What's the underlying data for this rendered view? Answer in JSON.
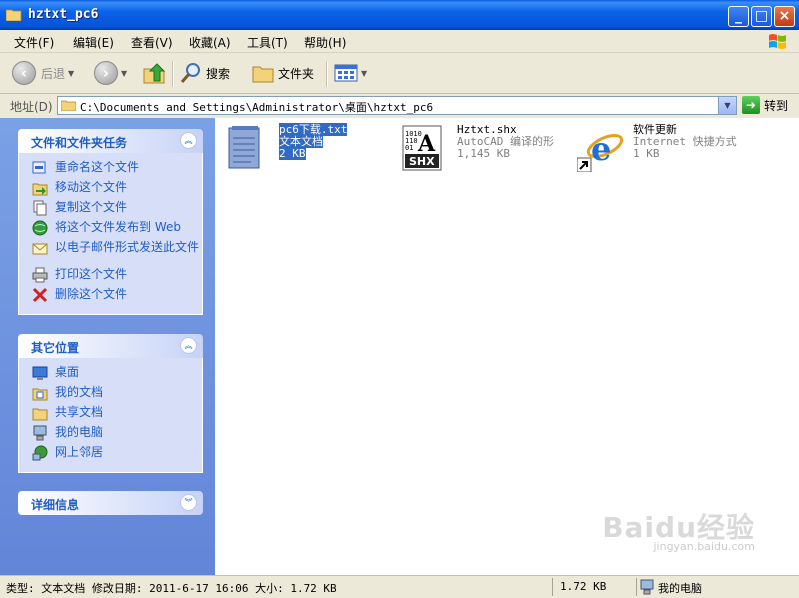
{
  "window": {
    "title": "hztxt_pc6"
  },
  "menu": [
    "文件(F)",
    "编辑(E)",
    "查看(V)",
    "收藏(A)",
    "工具(T)",
    "帮助(H)"
  ],
  "toolbar": {
    "back": "后退",
    "search": "搜索",
    "folders": "文件夹"
  },
  "address": {
    "label": "地址(D)",
    "path": "C:\\Documents and Settings\\Administrator\\桌面\\hztxt_pc6",
    "go": "转到"
  },
  "tasks_panel": {
    "title": "文件和文件夹任务",
    "items": [
      "重命名这个文件",
      "移动这个文件",
      "复制这个文件",
      "将这个文件发布到 Web",
      "以电子邮件形式发送此文件",
      "打印这个文件",
      "删除这个文件"
    ]
  },
  "places_panel": {
    "title": "其它位置",
    "items": [
      "桌面",
      "我的文档",
      "共享文档",
      "我的电脑",
      "网上邻居"
    ]
  },
  "details_panel": {
    "title": "详细信息"
  },
  "files": [
    {
      "name": "pc6下载.txt",
      "type": "文本文档",
      "size": "2 KB",
      "icon": "text-document-icon",
      "selected": true
    },
    {
      "name": "Hztxt.shx",
      "type": "AutoCAD 编译的形",
      "size": "1,145 KB",
      "icon": "shx-font-icon",
      "selected": false
    },
    {
      "name": "软件更新",
      "type": "Internet 快捷方式",
      "size": "1 KB",
      "icon": "internet-shortcut-icon",
      "selected": false
    }
  ],
  "status": {
    "info": "类型: 文本文档 修改日期: 2011-6-17 16:06 大小: 1.72 KB",
    "size": "1.72 KB",
    "location": "我的电脑"
  },
  "watermark": {
    "brand": "Baidu经验",
    "url": "jingyan.baidu.com"
  }
}
